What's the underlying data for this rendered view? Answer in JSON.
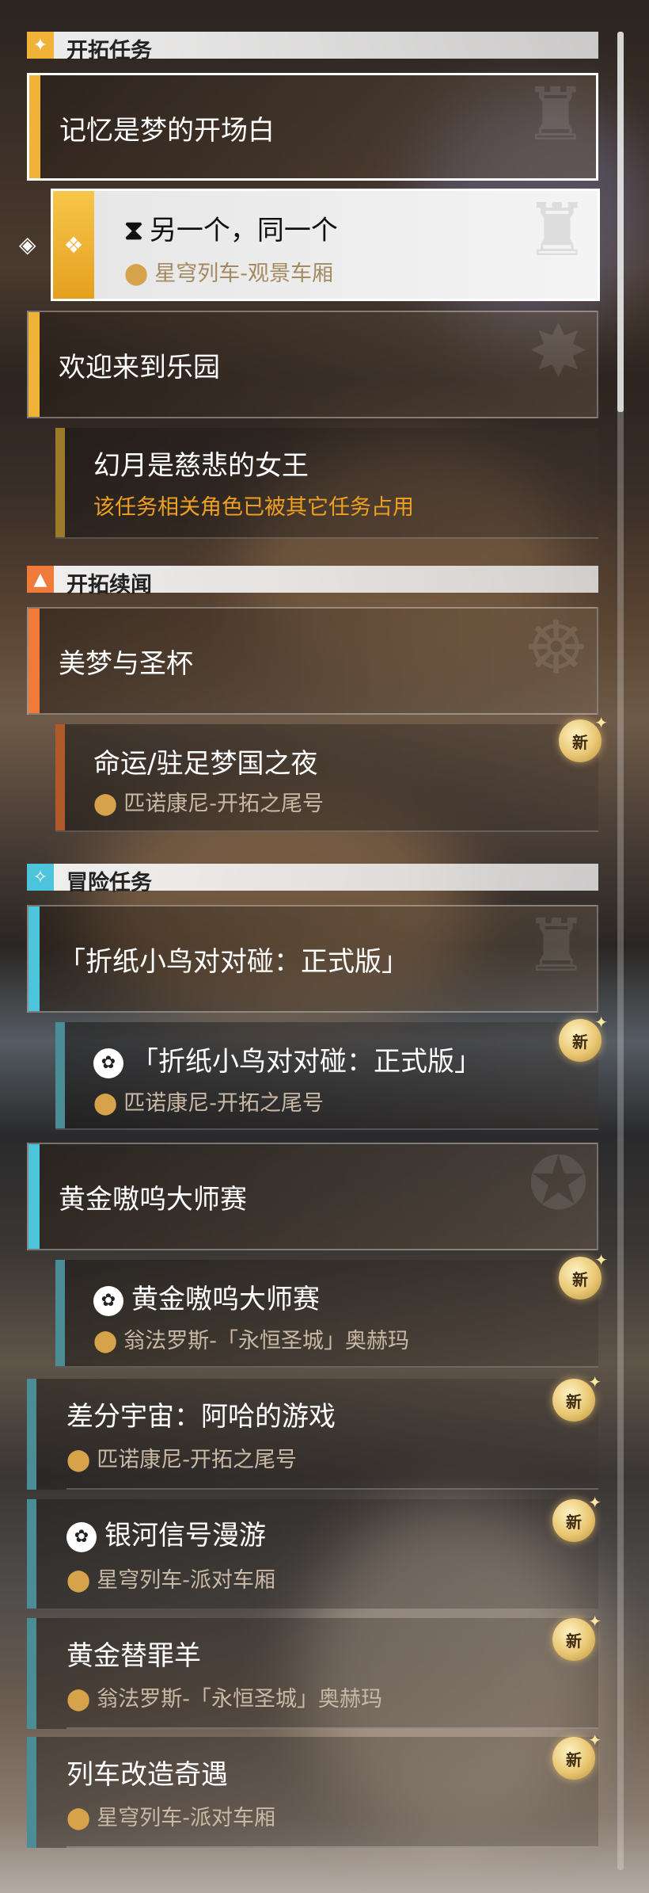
{
  "colors": {
    "gold": "#f0b338",
    "orange": "#f07a3a",
    "cyan": "#4cc4dc",
    "teal": "#4a8d96",
    "warning": "#f0a020",
    "location": "#c9b9a5"
  },
  "sections": {
    "trailblaze": {
      "title": "开拓任务",
      "icon": "trailblaze-diamond-icon"
    },
    "continuance": {
      "title": "开拓续闻",
      "icon": "triangle-icon"
    },
    "adventure": {
      "title": "冒险任务",
      "icon": "star-icon"
    }
  },
  "quests": {
    "q1": {
      "title": "记忆是梦的开场白"
    },
    "q1a": {
      "title": "另一个，同一个",
      "location": "星穹列车-观景车厢"
    },
    "q2": {
      "title": "欢迎来到乐园"
    },
    "q2a": {
      "title": "幻月是慈悲的女王",
      "warning": "该任务相关角色已被其它任务占用"
    },
    "q3": {
      "title": "美梦与圣杯"
    },
    "q3a": {
      "title": "命运/驻足梦国之夜",
      "location": "匹诺康尼-开拓之尾号",
      "badge": "新"
    },
    "q4": {
      "title": "「折纸小鸟对对碰：正式版」"
    },
    "q4a": {
      "title": "「折纸小鸟对对碰：正式版」",
      "location": "匹诺康尼-开拓之尾号",
      "badge": "新"
    },
    "q5": {
      "title": "黄金嗷呜大师赛"
    },
    "q5a": {
      "title": "黄金嗷呜大师赛",
      "location": "翁法罗斯-「永恒圣城」奥赫玛",
      "badge": "新"
    },
    "q6": {
      "title": "差分宇宙：阿哈的游戏",
      "location": "匹诺康尼-开拓之尾号",
      "badge": "新"
    },
    "q7": {
      "title": "银河信号漫游",
      "location": "星穹列车-派对车厢",
      "badge": "新"
    },
    "q8": {
      "title": "黄金替罪羊",
      "location": "翁法罗斯-「永恒圣城」奥赫玛",
      "badge": "新"
    },
    "q9": {
      "title": "列车改造奇遇",
      "location": "星穹列车-派对车厢",
      "badge": "新"
    }
  }
}
